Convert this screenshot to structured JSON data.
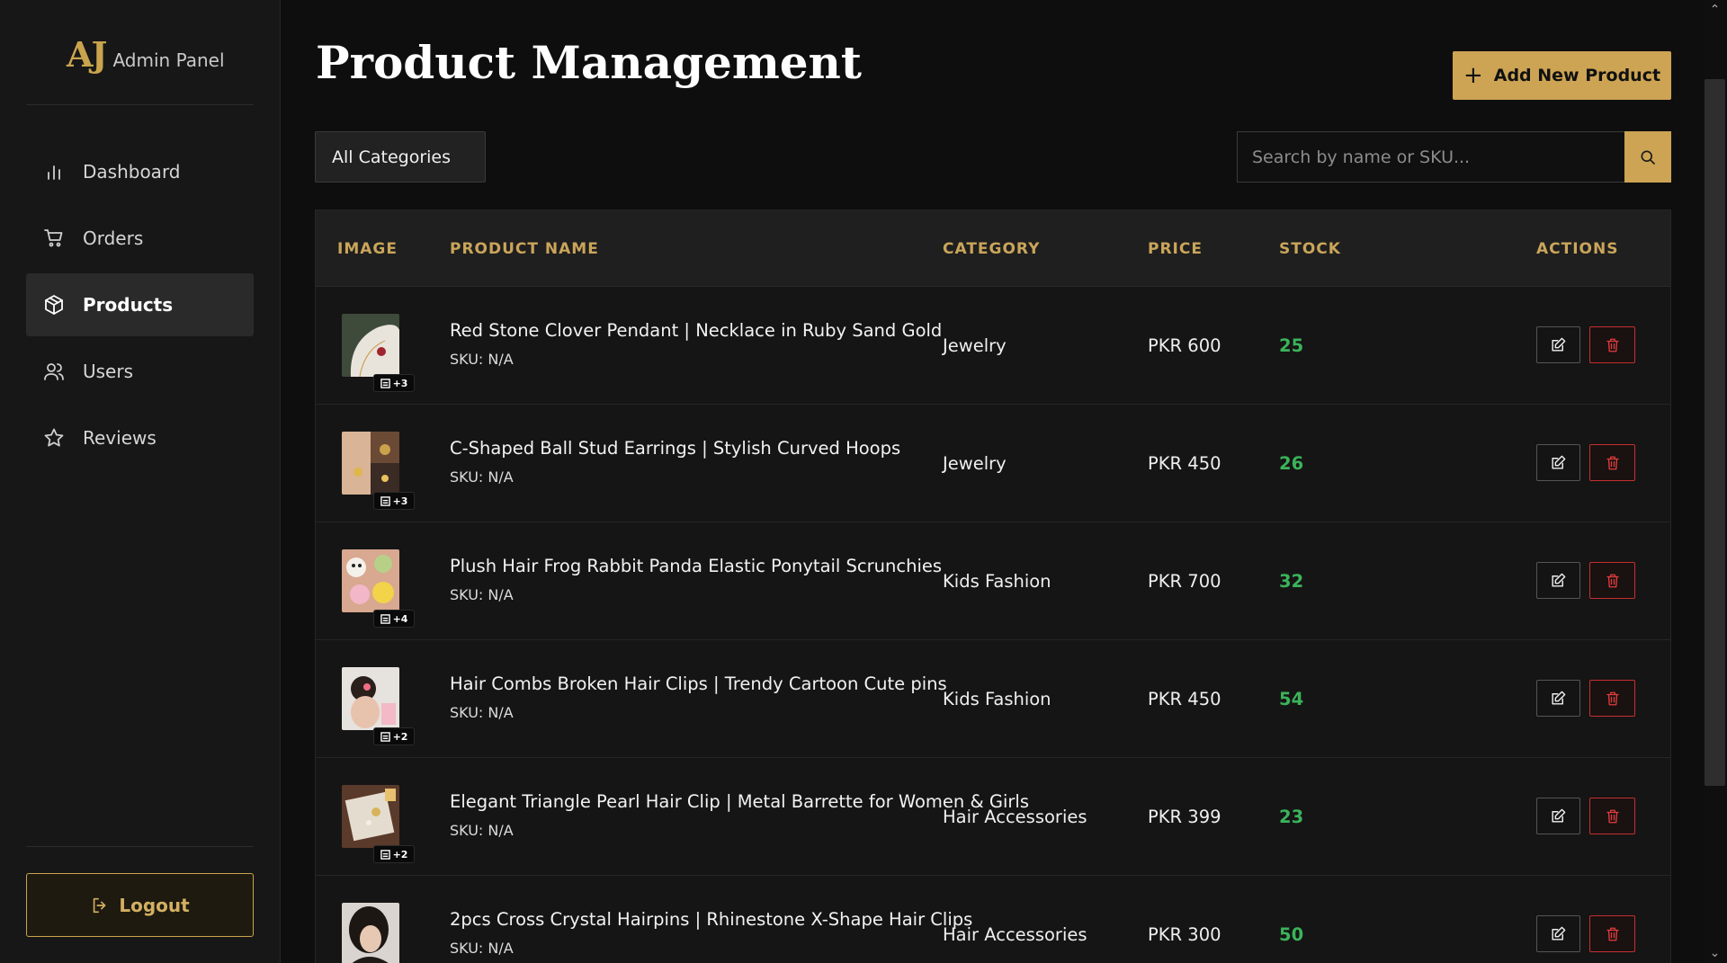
{
  "brand": {
    "logo": "AJ",
    "title": "Admin Panel"
  },
  "nav": {
    "items": [
      {
        "label": "Dashboard",
        "icon": "bar-chart-icon"
      },
      {
        "label": "Orders",
        "icon": "cart-icon"
      },
      {
        "label": "Products",
        "icon": "box-icon",
        "active": true
      },
      {
        "label": "Users",
        "icon": "users-icon"
      },
      {
        "label": "Reviews",
        "icon": "star-icon"
      }
    ],
    "logout_label": "Logout"
  },
  "header": {
    "title": "Product Management",
    "add_button_label": "Add New Product"
  },
  "filters": {
    "category_selected": "All Categories",
    "search_placeholder": "Search by name or SKU..."
  },
  "table": {
    "columns": [
      "IMAGE",
      "PRODUCT NAME",
      "CATEGORY",
      "PRICE",
      "STOCK",
      "ACTIONS"
    ],
    "rows": [
      {
        "name": "Red Stone Clover Pendant | Necklace in Ruby Sand Gold",
        "sku": "SKU: N/A",
        "category": "Jewelry",
        "price": "PKR 600",
        "stock": "25",
        "extra_images": "+3"
      },
      {
        "name": "C-Shaped Ball Stud Earrings | Stylish Curved Hoops",
        "sku": "SKU: N/A",
        "category": "Jewelry",
        "price": "PKR 450",
        "stock": "26",
        "extra_images": "+3"
      },
      {
        "name": "Plush Hair Frog Rabbit Panda Elastic Ponytail Scrunchies",
        "sku": "SKU: N/A",
        "category": "Kids Fashion",
        "price": "PKR 700",
        "stock": "32",
        "extra_images": "+4"
      },
      {
        "name": "Hair Combs Broken Hair Clips | Trendy Cartoon Cute pins",
        "sku": "SKU: N/A",
        "category": "Kids Fashion",
        "price": "PKR 450",
        "stock": "54",
        "extra_images": "+2"
      },
      {
        "name": "Elegant Triangle Pearl Hair Clip | Metal Barrette for Women & Girls",
        "sku": "SKU: N/A",
        "category": "Hair Accessories",
        "price": "PKR 399",
        "stock": "23",
        "extra_images": "+2"
      },
      {
        "name": "2pcs Cross Crystal Hairpins | Rhinestone X-Shape Hair Clips",
        "sku": "SKU: N/A",
        "category": "Hair Accessories",
        "price": "PKR 300",
        "stock": "50",
        "extra_images": ""
      }
    ]
  },
  "colors": {
    "accent": "#cda453",
    "stock": "#3bb35a",
    "danger": "#e03d3d"
  }
}
